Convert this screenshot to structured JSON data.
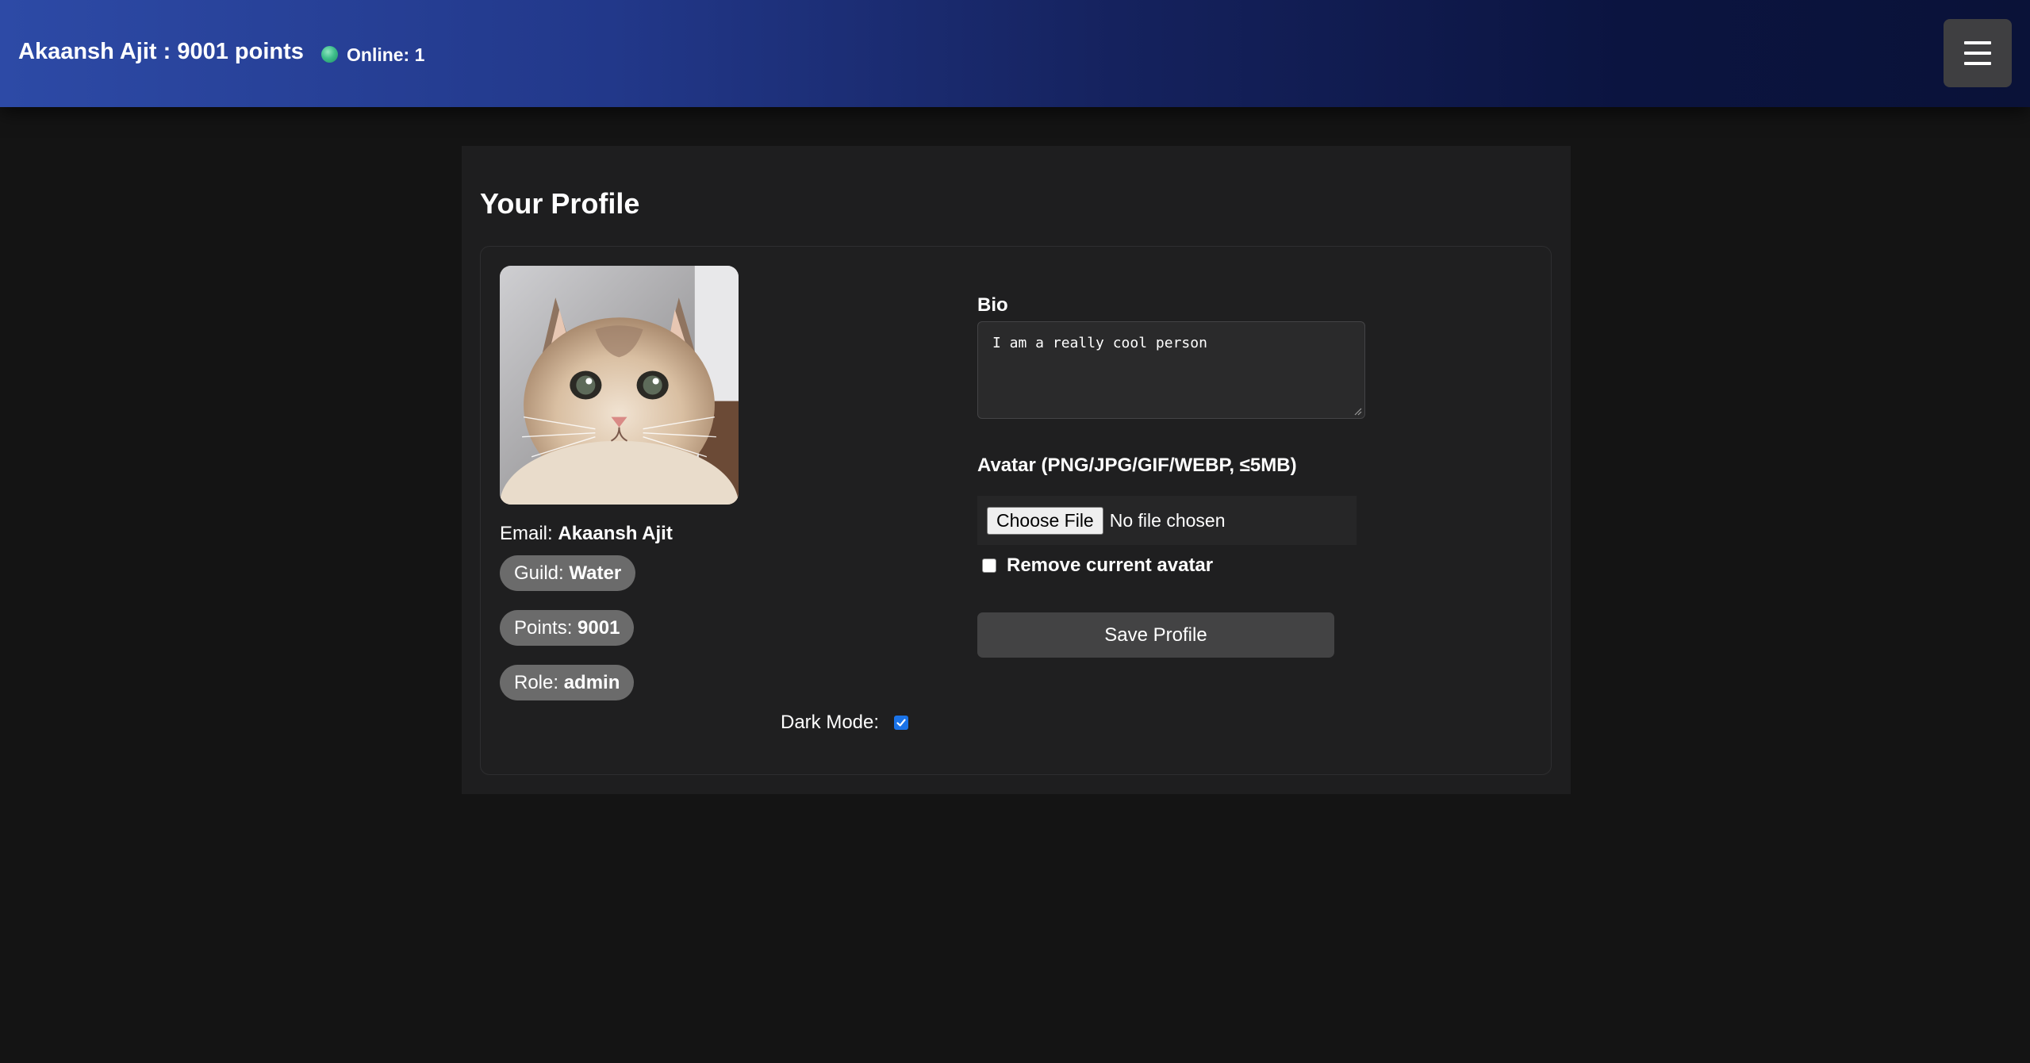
{
  "header": {
    "user_points": "Akaansh Ajit : 9001 points",
    "online_label": "Online: 1",
    "menu_icon": "hamburger-menu-icon"
  },
  "profile": {
    "title": "Your Profile",
    "avatar_description_icon": "cat-photo",
    "email_label": "Email: ",
    "email_value": "Akaansh Ajit",
    "guild_label": "Guild: ",
    "guild_value": "Water",
    "points_label": "Points: ",
    "points_value": "9001",
    "role_label": "Role: ",
    "role_value": "admin",
    "dark_mode_label": "Dark Mode:",
    "dark_mode_checked": true
  },
  "form": {
    "bio_label": "Bio",
    "bio_value": "I am a really cool person",
    "avatar_label": "Avatar (PNG/JPG/GIF/WEBP, ≤5MB)",
    "choose_file_label": "Choose File",
    "file_status": "No file chosen",
    "remove_avatar_label": "Remove current avatar",
    "remove_avatar_checked": false,
    "save_label": "Save Profile"
  },
  "colors": {
    "background": "#141414",
    "panel": "#1e1e1f",
    "online_indicator": "#3fbf8c",
    "checkbox_accent": "#1a73e8"
  }
}
